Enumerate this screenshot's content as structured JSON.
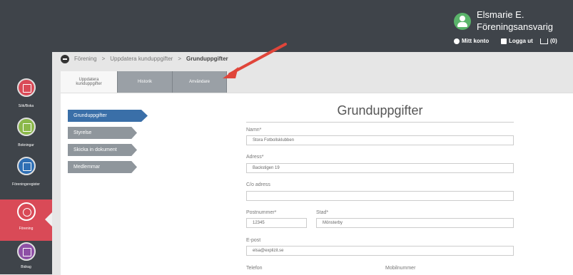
{
  "header": {
    "user_name": "Elsmarie E.",
    "user_role": "Föreningsansvarig",
    "my_account": "Mitt konto",
    "logout": "Logga ut",
    "cart": "(0)"
  },
  "sidebar": {
    "items": [
      {
        "label": "Sök/Boka",
        "icon": "calendar-icon",
        "color": "#d94a57"
      },
      {
        "label": "Bokningar",
        "icon": "calendar-check-icon",
        "color": "#8bb84a"
      },
      {
        "label": "Föreningsregister",
        "icon": "list-icon",
        "color": "#2f6fb4"
      },
      {
        "label": "Förening",
        "icon": "people-icon",
        "color": "#d94a57"
      },
      {
        "label": "Bidrag",
        "icon": "calculator-icon",
        "color": "#8e4fa6"
      }
    ]
  },
  "breadcrumb": {
    "items": [
      "Förening",
      "Uppdatera kunduppgifter",
      "Grunduppgifter"
    ],
    "separator": ">"
  },
  "tabs": [
    {
      "label": "Uppdatera kunduppgifter",
      "active": true
    },
    {
      "label": "Historik",
      "active": false
    },
    {
      "label": "Användare",
      "active": false
    }
  ],
  "left_menu": [
    "Grunduppgifter",
    "Styrelse",
    "Skicka in dokument",
    "Medlemmar"
  ],
  "form": {
    "title": "Grunduppgifter",
    "fields": {
      "namn": {
        "label": "Namn*",
        "value": "Stora Fotbollsklubben"
      },
      "adress": {
        "label": "Adress*",
        "value": "Backstigen 19"
      },
      "co_adress": {
        "label": "C/o adress",
        "value": ""
      },
      "postnummer": {
        "label": "Postnummer*",
        "value": "12345"
      },
      "stad": {
        "label": "Stad*",
        "value": "Mönsterby"
      },
      "epost": {
        "label": "E-post",
        "value": "elsa@explizit.se"
      },
      "telefon": {
        "label": "Telefon",
        "value": ""
      },
      "mobilnummer": {
        "label": "Mobilnummer",
        "value": ""
      }
    }
  },
  "colors": {
    "accent": "#d94a57",
    "arrow": "#e0453a",
    "active_menu": "#3a6fa8"
  }
}
